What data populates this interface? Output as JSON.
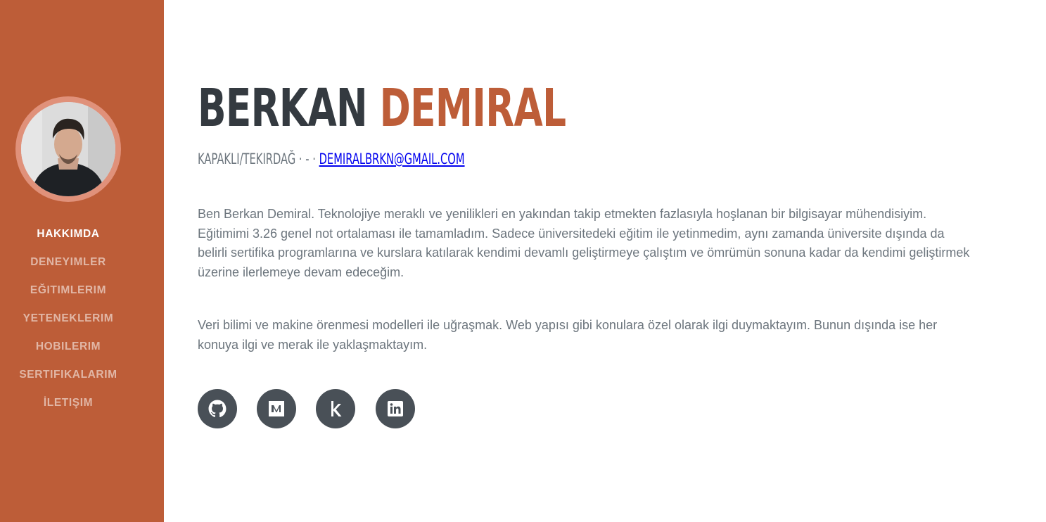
{
  "sidebar": {
    "avatar_alt": "profile photo",
    "nav": [
      {
        "label": "HAKKIMDA",
        "active": true
      },
      {
        "label": "DENEYIMLER",
        "active": false
      },
      {
        "label": "EĞITIMLERIM",
        "active": false
      },
      {
        "label": "YETENEKLERIM",
        "active": false
      },
      {
        "label": "HOBILERIM",
        "active": false
      },
      {
        "label": "SERTIFIKALARIM",
        "active": false
      },
      {
        "label": "İLETIŞIM",
        "active": false
      }
    ]
  },
  "main": {
    "first_name": "BERKAN",
    "last_name": "DEMIRAL",
    "location": "KAPAKLI/TEKIRDAĞ · - · ",
    "email": "DEMIRALBRKN@GMAIL.COM",
    "paragraph1": "Ben Berkan Demiral. Teknolojiye meraklı ve yenilikleri en yakından takip etmekten fazlasıyla hoşlanan bir bilgisayar mühendisiyim. Eğitimimi 3.26 genel not ortalaması ile tamamladım. Sadece üniversitedeki eğitim ile yetinmedim, aynı zamanda üniversite dışında da belirli sertifika programlarına ve kurslara katılarak kendimi devamlı geliştirmeye çalıştım ve ömrümün sonuna kadar da kendimi geliştirmek üzerine ilerlemeye devam edeceğim.",
    "paragraph2": "Veri bilimi ve makine örenmesi modelleri ile uğraşmak. Web yapısı gibi konulara özel olarak ilgi duymaktayım. Bunun dışında ise her konuya ilgi ve merak ile yaklaşmaktayım.",
    "socials": [
      {
        "icon": "github-icon"
      },
      {
        "icon": "medium-icon"
      },
      {
        "icon": "kaggle-icon"
      },
      {
        "icon": "linkedin-icon"
      }
    ]
  },
  "colors": {
    "primary": "#bd5d38",
    "dark": "#343a40",
    "muted": "#6c757d",
    "social_bg": "#495057"
  }
}
